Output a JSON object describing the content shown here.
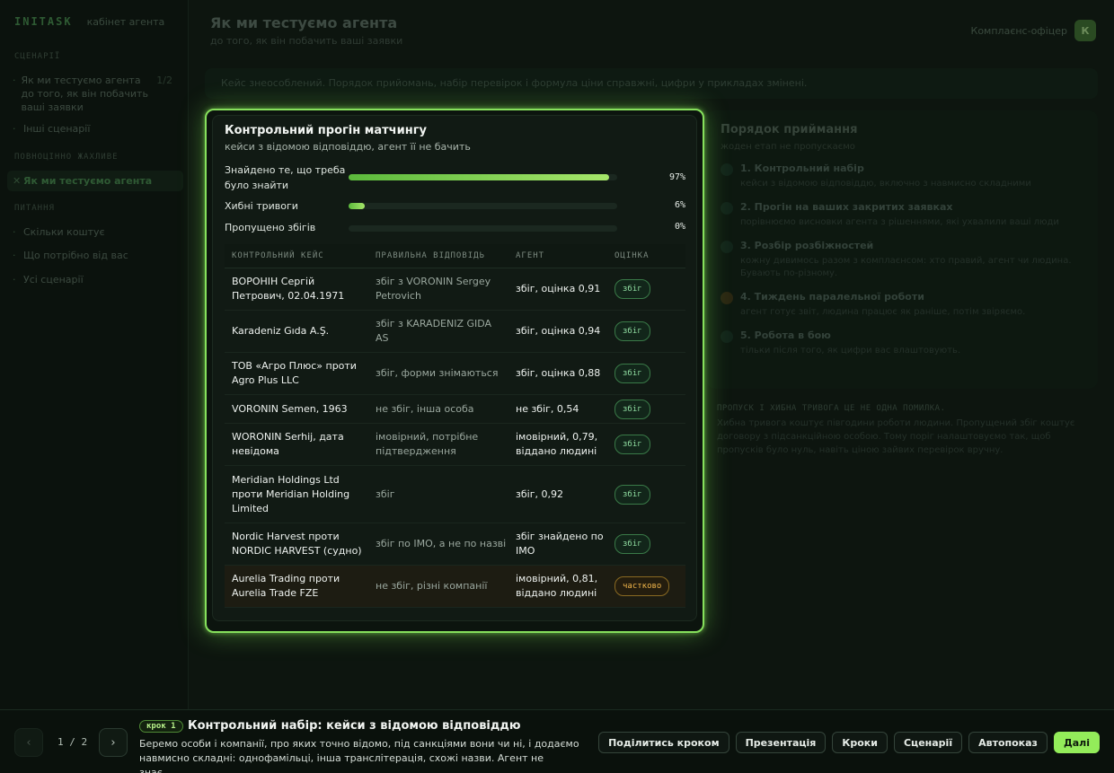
{
  "brand": {
    "logo": "INITASK",
    "sub": "кабінет агента"
  },
  "sidebar": {
    "section1": "СЦЕНАРІЇ",
    "section2": "ПОВНОЦІННО ЖАХЛИВЕ",
    "section3": "ПИТАННЯ",
    "items_top": [
      {
        "label": "Як ми тестуємо агента до того, як він побачить ваші заявки",
        "count": "1/2"
      },
      {
        "label": "Інші сценарії"
      }
    ],
    "active_item": "Як ми тестуємо агента",
    "items_bottom": [
      {
        "label": "Скільки коштує"
      },
      {
        "label": "Що потрібно від вас"
      },
      {
        "label": "Усі сценарії"
      }
    ]
  },
  "header": {
    "title": "Як ми тестуємо агента",
    "subtitle": "до того, як він побачить ваші заявки",
    "user_name": "Комплаєнс-офіцер",
    "avatar_letter": "К"
  },
  "notice": "Кейс знеособлений. Порядок прийомань, набір перевірок і формула ціни справжні, цифри у прикладах змінені.",
  "right_panel": {
    "title": "Порядок приймання",
    "subtitle": "жоден етап не пропускаємо",
    "steps": [
      {
        "title": "1. Контрольний набір",
        "desc": "кейси з відомою відповіддю, включно з навмисно складними"
      },
      {
        "title": "2. Прогін на ваших закритих заявках",
        "desc": "порівнюємо висновки агента з рішеннями, які ухвалили ваші люди"
      },
      {
        "title": "3. Розбір розбіжностей",
        "desc": "кожну дивимось разом з комплаєнсом: хто правий, агент чи людина. Бувають по-різному."
      },
      {
        "title": "4. Тиждень паралельної роботи",
        "desc": "агент готує звіт, людина працює як раніше, потім звіряємо."
      },
      {
        "title": "5. Робота в бою",
        "desc": "тільки після того, як цифри вас влаштовують."
      }
    ]
  },
  "side_note": {
    "heading": "ПРОПУСК І ХИБНА ТРИВОГА ЦЕ НЕ ОДНА ПОМИЛКА.",
    "text": "Хибна тривога коштує півгодини роботи людини. Пропущений збіг коштує договору з підсанкційною особою. Тому поріг налаштовуємо так, щоб пропусків було нуль, навіть ціною зайвих перевірок вручну."
  },
  "card": {
    "title": "Контрольний прогін матчингу",
    "subtitle": "кейси з відомою відповіддю, агент її не бачить",
    "metrics": [
      {
        "label": "Знайдено те, що треба було знайти",
        "value": 0.97,
        "pct": "97%"
      },
      {
        "label": "Хибні тривоги",
        "value": 0.06,
        "pct": "6%"
      },
      {
        "label": "Пропущено збігів",
        "value": 0,
        "pct": "0%"
      }
    ],
    "columns": [
      "КОНТРОЛЬНИЙ КЕЙС",
      "ПРАВИЛЬНА ВІДПОВІДЬ",
      "АГЕНТ",
      "ОЦІНКА"
    ],
    "rows": [
      {
        "case": "ВОРОНІН Сергій Петрович, 02.04.1971",
        "answer": "збіг з VORONIN Sergey Petrovich",
        "agent": "збіг, оцінка 0,91",
        "grade": "збіг",
        "status": "ok"
      },
      {
        "case": "Karadeniz Gıda A.Ş.",
        "answer": "збіг з KARADENIZ GIDA AS",
        "agent": "збіг, оцінка 0,94",
        "grade": "збіг",
        "status": "ok"
      },
      {
        "case": "ТОВ «Агро Плюс» проти Agro Plus LLC",
        "answer": "збіг, форми знімаються",
        "agent": "збіг, оцінка 0,88",
        "grade": "збіг",
        "status": "ok"
      },
      {
        "case": "VORONIN Semen, 1963",
        "answer": "не збіг, інша особа",
        "agent": "не збіг, 0,54",
        "grade": "збіг",
        "status": "ok"
      },
      {
        "case": "WORONIN Serhij, дата невідома",
        "answer": "імовірний, потрібне підтвердження",
        "agent": "імовірний, 0,79, віддано людині",
        "grade": "збіг",
        "status": "ok"
      },
      {
        "case": "Meridian Holdings Ltd проти Meridian Holding Limited",
        "answer": "збіг",
        "agent": "збіг, 0,92",
        "grade": "збіг",
        "status": "ok"
      },
      {
        "case": "Nordic Harvest проти NORDIC HARVEST (судно)",
        "answer": "збіг по IMO, а не по назві",
        "agent": "збіг знайдено по IMO",
        "grade": "збіг",
        "status": "ok"
      },
      {
        "case": "Aurelia Trading проти Aurelia Trade FZE",
        "answer": "не збіг, різні компанії",
        "agent": "імовірний, 0,81, віддано людині",
        "grade": "частково",
        "status": "warn"
      }
    ]
  },
  "bottom": {
    "prev": "‹",
    "next": "›",
    "pager": "1 / 2",
    "step_pill": "крок 1",
    "step_title": "Контрольний набір: кейси з відомою відповіддю",
    "step_desc": "Беремо особи і компанії, про яких точно відомо, під санкціями вони чи ні, і додаємо навмисно складні: однофамільці, інша транслітерація, схожі назви. Агент не знає…",
    "actions": [
      "Поділитись кроком",
      "Презентація",
      "Кроки",
      "Сценарії",
      "Автопоказ",
      "Далі"
    ]
  },
  "colors": {
    "accent": "#93ec5a",
    "bar": "#a6e66a",
    "warn": "#f0b54a",
    "ok": "#8fdca0"
  }
}
